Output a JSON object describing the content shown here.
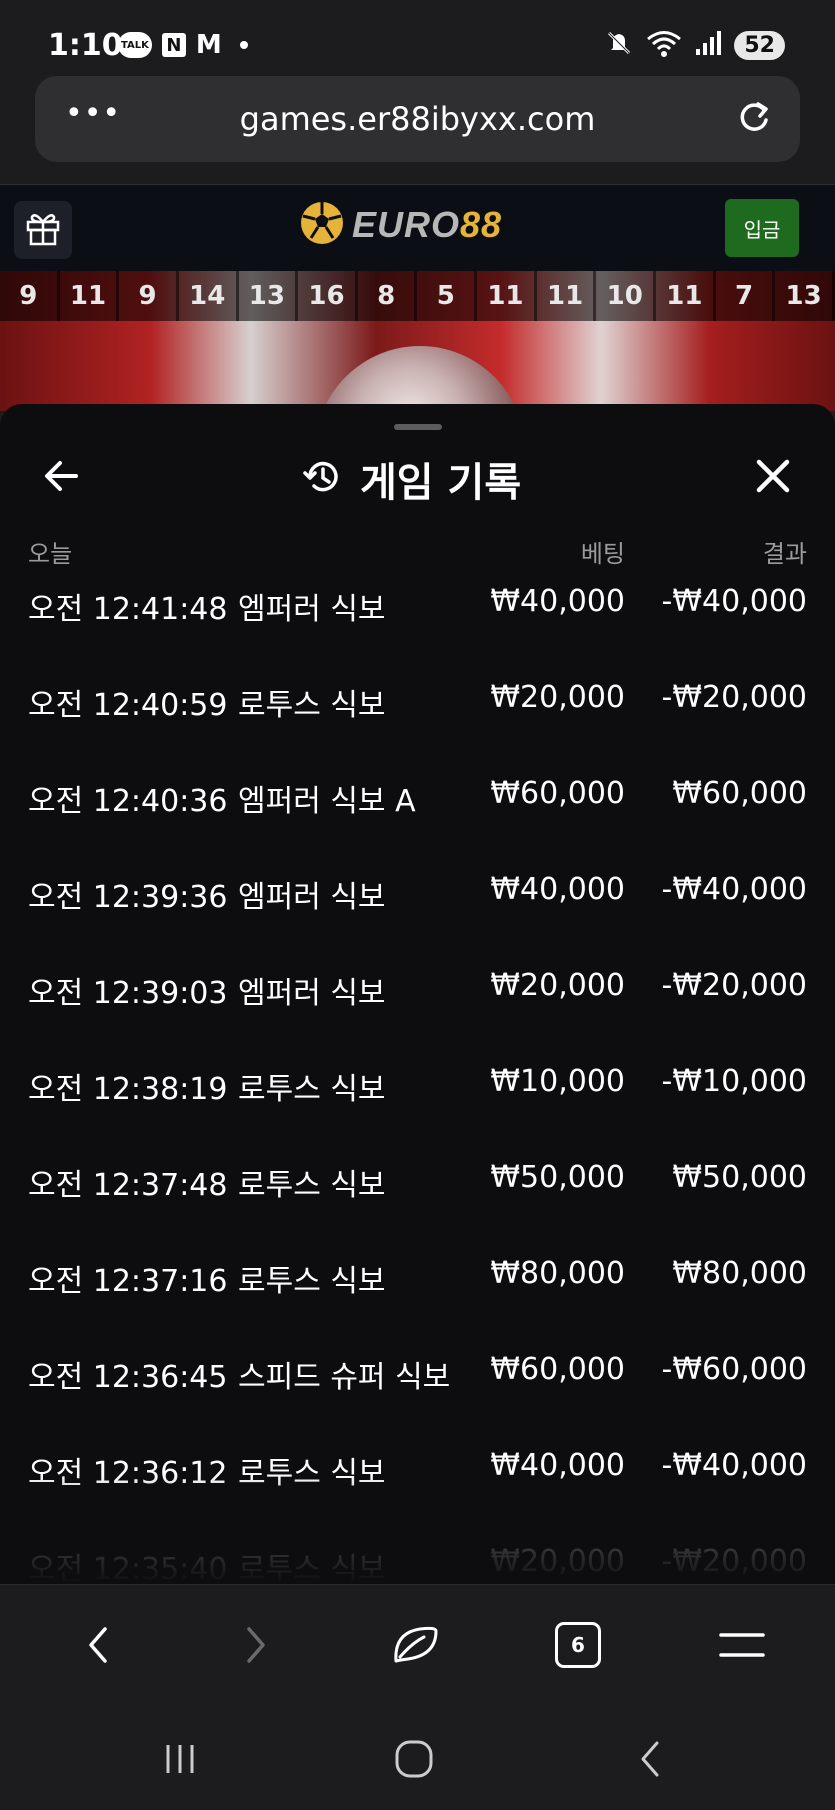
{
  "status_bar": {
    "time": "1:10",
    "badge_talk": "TALK",
    "badge_n": "N",
    "badge_m": "M",
    "battery": "52"
  },
  "browser": {
    "url": "games.er88ibyxx.com",
    "menu_dots": "•••",
    "tabs_count": "6"
  },
  "site": {
    "logo_prefix": "EURO",
    "logo_suffix": "88",
    "deposit_label": "입금",
    "accent": "#e6b33a",
    "deposit_color": "#1e6a1e"
  },
  "history_strip": [
    "9",
    "11",
    "9",
    "14",
    "13",
    "16",
    "8",
    "5",
    "11",
    "11",
    "10",
    "11",
    "7",
    "13"
  ],
  "game_history": {
    "title": "게임 기록",
    "col_date": "오늘",
    "col_bet": "베팅",
    "col_result": "결과",
    "rows": [
      {
        "time": "오전 12:41:48",
        "game": "엠퍼러 식보",
        "bet": "₩40,000",
        "result": "-₩40,000"
      },
      {
        "time": "오전 12:40:59",
        "game": "로투스 식보",
        "bet": "₩20,000",
        "result": "-₩20,000"
      },
      {
        "time": "오전 12:40:36",
        "game": "엠퍼러 식보 A",
        "bet": "₩60,000",
        "result": "₩60,000"
      },
      {
        "time": "오전 12:39:36",
        "game": "엠퍼러 식보",
        "bet": "₩40,000",
        "result": "-₩40,000"
      },
      {
        "time": "오전 12:39:03",
        "game": "엠퍼러 식보",
        "bet": "₩20,000",
        "result": "-₩20,000"
      },
      {
        "time": "오전 12:38:19",
        "game": "로투스 식보",
        "bet": "₩10,000",
        "result": "-₩10,000"
      },
      {
        "time": "오전 12:37:48",
        "game": "로투스 식보",
        "bet": "₩50,000",
        "result": "₩50,000"
      },
      {
        "time": "오전 12:37:16",
        "game": "로투스 식보",
        "bet": "₩80,000",
        "result": "₩80,000"
      },
      {
        "time": "오전 12:36:45",
        "game": "스피드 슈퍼 식보",
        "bet": "₩60,000",
        "result": "-₩60,000"
      },
      {
        "time": "오전 12:36:12",
        "game": "로투스 식보",
        "bet": "₩40,000",
        "result": "-₩40,000"
      },
      {
        "time": "오전 12:35:40",
        "game": "로투스 식보",
        "bet": "₩20,000",
        "result": "-₩20,000"
      }
    ]
  }
}
